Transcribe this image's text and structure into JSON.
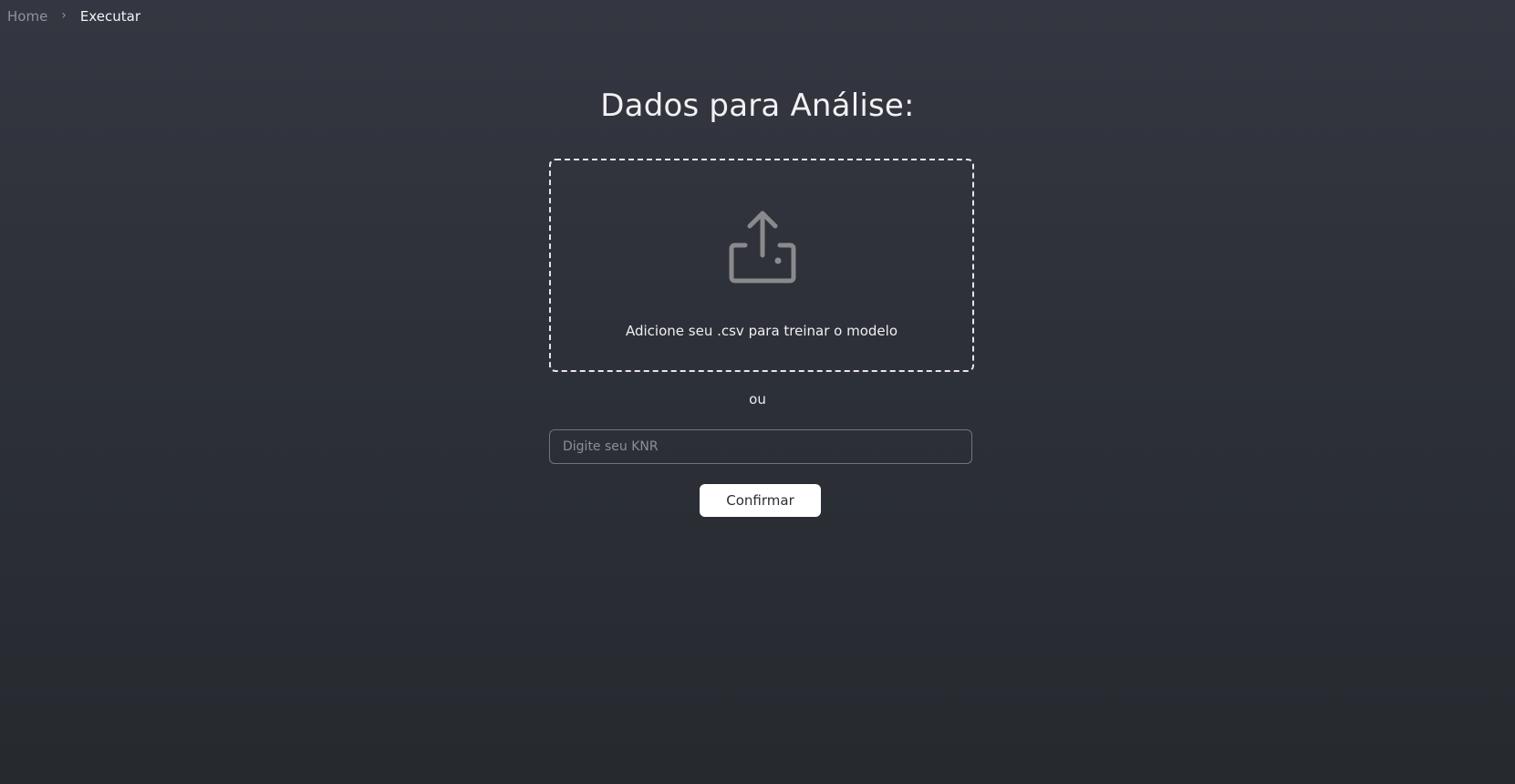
{
  "breadcrumb": {
    "home_label": "Home",
    "separator": "›",
    "current_label": "Executar"
  },
  "main": {
    "title": "Dados para Análise:",
    "dropzone": {
      "icon": "upload-icon",
      "text": "Adicione seu .csv para treinar o modelo"
    },
    "or_label": "ou",
    "knr_input": {
      "value": "",
      "placeholder": "Digite seu KNR"
    },
    "confirm_label": "Confirmar"
  },
  "colors": {
    "background_top": "#343741",
    "background_bottom": "#262a2f",
    "icon_gray": "#8a8a8c",
    "button_bg": "#ffffff",
    "button_text": "#2b2e35"
  }
}
